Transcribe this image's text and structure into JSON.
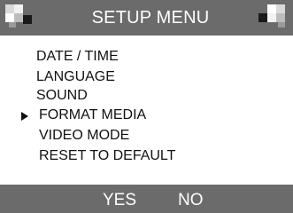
{
  "header": {
    "title": "SETUP MENU",
    "left_icon": "checker-logo-icon",
    "right_icon": "checker-logo-icon"
  },
  "menu": {
    "items": [
      {
        "label": "DATE / TIME"
      },
      {
        "label": "LANGUAGE"
      },
      {
        "label": "SOUND"
      },
      {
        "label": "FORMAT MEDIA",
        "selected": true
      },
      {
        "label": "VIDEO MODE"
      },
      {
        "label": "RESET TO DEFAULT"
      }
    ],
    "cursor_icon": "triangle-pointer-icon"
  },
  "footer": {
    "yes_label": "YES",
    "no_label": "NO"
  },
  "colors": {
    "bar": "#6b6b6b",
    "bar_text": "#ffffff",
    "menu_bg": "#ffffff",
    "menu_text": "#111111"
  }
}
